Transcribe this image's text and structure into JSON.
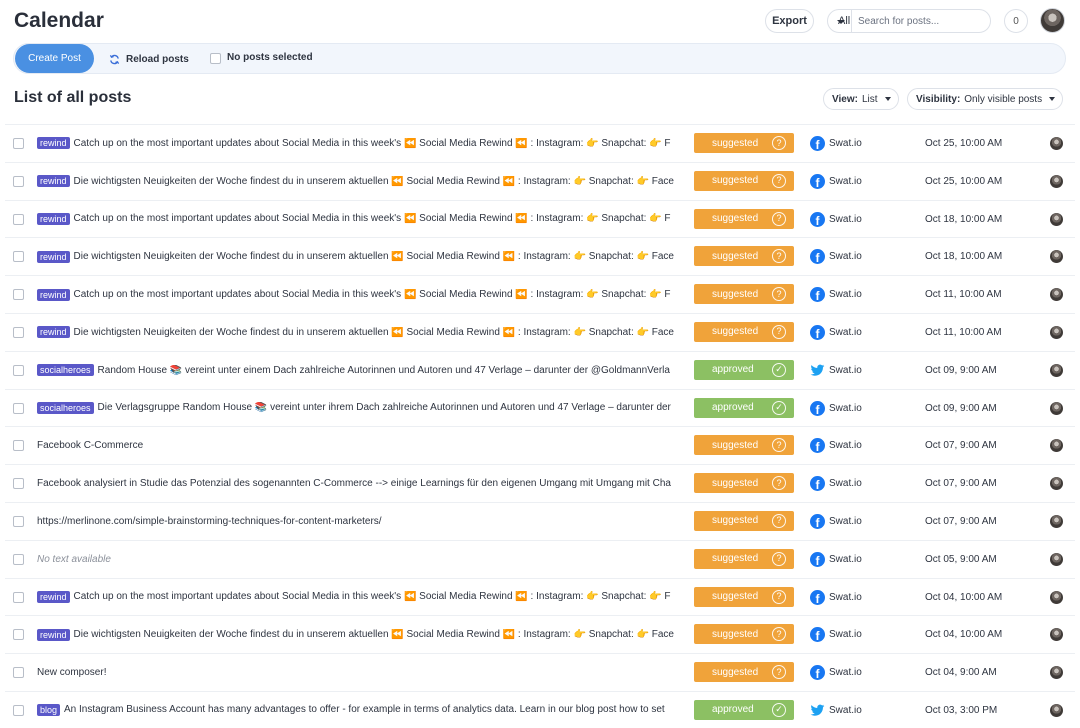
{
  "header": {
    "title": "Calendar",
    "export_label": "Export",
    "filter_value": "All",
    "search_placeholder": "Search for posts...",
    "notification_count": "0"
  },
  "toolbar": {
    "create_label": "Create Post",
    "reload_label": "Reload posts",
    "selection_label": "No posts selected"
  },
  "list": {
    "title": "List of all posts",
    "view_label": "View:",
    "view_value": "List",
    "visibility_label": "Visibility:",
    "visibility_value": "Only visible posts"
  },
  "colors": {
    "accent": "#4a90e2",
    "suggested": "#f0a33a",
    "approved": "#8cc063",
    "tag": "#5a58c8",
    "facebook": "#1877f2",
    "twitter": "#1da1f2"
  },
  "posts": [
    {
      "tag": "rewind",
      "text": "Catch up on the most important updates about Social Media in this week's ⏪ Social Media Rewind ⏪ : Instagram: 👉 Snapchat: 👉 F",
      "status": "suggested",
      "network": "facebook",
      "account": "Swat.io",
      "date": "Oct 25, 10:00 AM"
    },
    {
      "tag": "rewind",
      "text": "Die wichtigsten Neuigkeiten der Woche findest du in unserem aktuellen ⏪ Social Media Rewind ⏪ : Instagram: 👉 Snapchat: 👉 Face",
      "status": "suggested",
      "network": "facebook",
      "account": "Swat.io",
      "date": "Oct 25, 10:00 AM"
    },
    {
      "tag": "rewind",
      "text": "Catch up on the most important updates about Social Media in this week's ⏪ Social Media Rewind ⏪ : Instagram: 👉 Snapchat: 👉 F",
      "status": "suggested",
      "network": "facebook",
      "account": "Swat.io",
      "date": "Oct 18, 10:00 AM"
    },
    {
      "tag": "rewind",
      "text": "Die wichtigsten Neuigkeiten der Woche findest du in unserem aktuellen ⏪ Social Media Rewind ⏪ : Instagram: 👉 Snapchat: 👉 Face",
      "status": "suggested",
      "network": "facebook",
      "account": "Swat.io",
      "date": "Oct 18, 10:00 AM"
    },
    {
      "tag": "rewind",
      "text": "Catch up on the most important updates about Social Media in this week's ⏪ Social Media Rewind ⏪ : Instagram: 👉 Snapchat: 👉 F",
      "status": "suggested",
      "network": "facebook",
      "account": "Swat.io",
      "date": "Oct 11, 10:00 AM"
    },
    {
      "tag": "rewind",
      "text": "Die wichtigsten Neuigkeiten der Woche findest du in unserem aktuellen ⏪ Social Media Rewind ⏪ : Instagram: 👉 Snapchat: 👉 Face",
      "status": "suggested",
      "network": "facebook",
      "account": "Swat.io",
      "date": "Oct 11, 10:00 AM"
    },
    {
      "tag": "socialheroes",
      "text": "Random House 📚 vereint unter einem Dach zahlreiche Autorinnen und Autoren und 47 Verlage – darunter der @GoldmannVerla",
      "status": "approved",
      "network": "twitter",
      "account": "Swat.io",
      "date": "Oct 09, 9:00 AM"
    },
    {
      "tag": "socialheroes",
      "text": "Die Verlagsgruppe Random House 📚 vereint unter ihrem Dach zahlreiche Autorinnen und Autoren und 47 Verlage – darunter der",
      "status": "approved",
      "network": "facebook",
      "account": "Swat.io",
      "date": "Oct 09, 9:00 AM"
    },
    {
      "tag": "",
      "text": "Facebook C-Commerce",
      "status": "suggested",
      "network": "facebook",
      "account": "Swat.io",
      "date": "Oct 07, 9:00 AM"
    },
    {
      "tag": "",
      "text": "Facebook analysiert in Studie das Potenzial des sogenannten C-Commerce --> einige Learnings für den eigenen Umgang mit Umgang mit Cha",
      "status": "suggested",
      "network": "facebook",
      "account": "Swat.io",
      "date": "Oct 07, 9:00 AM"
    },
    {
      "tag": "",
      "text": "https://merlinone.com/simple-brainstorming-techniques-for-content-marketers/",
      "status": "suggested",
      "network": "facebook",
      "account": "Swat.io",
      "date": "Oct 07, 9:00 AM"
    },
    {
      "tag": "",
      "text": "No text available",
      "muted": true,
      "status": "suggested",
      "network": "facebook",
      "account": "Swat.io",
      "date": "Oct 05, 9:00 AM"
    },
    {
      "tag": "rewind",
      "text": "Catch up on the most important updates about Social Media in this week's ⏪ Social Media Rewind ⏪ : Instagram: 👉 Snapchat: 👉 F",
      "status": "suggested",
      "network": "facebook",
      "account": "Swat.io",
      "date": "Oct 04, 10:00 AM"
    },
    {
      "tag": "rewind",
      "text": "Die wichtigsten Neuigkeiten der Woche findest du in unserem aktuellen ⏪ Social Media Rewind ⏪ : Instagram: 👉 Snapchat: 👉 Face",
      "status": "suggested",
      "network": "facebook",
      "account": "Swat.io",
      "date": "Oct 04, 10:00 AM"
    },
    {
      "tag": "",
      "text": "New composer!",
      "status": "suggested",
      "network": "facebook",
      "account": "Swat.io",
      "date": "Oct 04, 9:00 AM"
    },
    {
      "tag": "blog",
      "text": "An Instagram Business Account has many advantages to offer - for example in terms of analytics data. Learn in our blog post how to set",
      "status": "approved",
      "network": "twitter",
      "account": "Swat.io",
      "date": "Oct 03, 3:00 PM"
    }
  ]
}
